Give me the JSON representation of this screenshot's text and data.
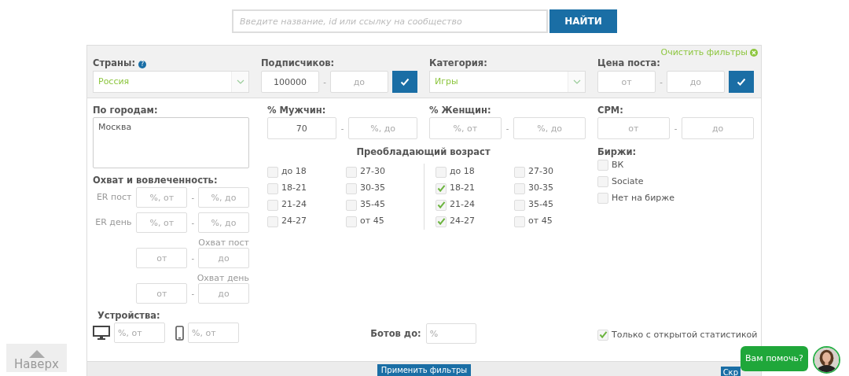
{
  "search": {
    "placeholder": "Введите название, id или ссылку на сообщество",
    "button": "НАЙТИ"
  },
  "clear_filters": {
    "label": "Очистить фильтры"
  },
  "header_filters": [
    {
      "kind": "select",
      "label": "Страны:",
      "help": "?",
      "value": "Россия"
    },
    {
      "kind": "range",
      "label": "Подписчиков:",
      "from": {
        "value": "100000"
      },
      "separator": "-",
      "to": {
        "placeholder": "до"
      },
      "apply": true
    },
    {
      "kind": "select",
      "label": "Категория:",
      "value": "Игры"
    },
    {
      "kind": "range",
      "label": "Цена поста:",
      "from": {
        "placeholder": "от"
      },
      "separator": "-",
      "to": {
        "placeholder": "до"
      },
      "apply": true
    }
  ],
  "cities": {
    "label": "По городам:",
    "value": "Москва"
  },
  "reach": {
    "label": "Охват и вовлеченность:",
    "rows": [
      {
        "kind": "labeled",
        "label": "ER пост",
        "from": {
          "placeholder": "%, от"
        },
        "separator": "-",
        "to": {
          "placeholder": "%, до"
        }
      },
      {
        "kind": "labeled",
        "label": "ER день",
        "from": {
          "placeholder": "%, от"
        },
        "separator": "-",
        "to": {
          "placeholder": "%, до"
        }
      },
      {
        "kind": "captioned",
        "label": "Охват пост",
        "from": {
          "placeholder": "от"
        },
        "separator": "-",
        "to": {
          "placeholder": "до"
        }
      },
      {
        "kind": "captioned",
        "label": "Охват день",
        "from": {
          "placeholder": "от"
        },
        "separator": "-",
        "to": {
          "placeholder": "до"
        }
      }
    ]
  },
  "devices": {
    "label": "Устройства:",
    "items": [
      {
        "kind": "desktop",
        "placeholder": "%, от"
      },
      {
        "kind": "mobile",
        "placeholder": "%, от"
      }
    ]
  },
  "men": {
    "label": "% Мужчин:",
    "from": {
      "value": "70"
    },
    "separator": "-",
    "to": {
      "placeholder": "%, до"
    }
  },
  "women": {
    "label": "% Женщин:",
    "from": {
      "placeholder": "%, от"
    },
    "separator": "-",
    "to": {
      "placeholder": "%, до"
    }
  },
  "age": {
    "title": "Преобладающий возраст",
    "groups": [
      {
        "options": [
          {
            "label": "до 18",
            "checked": false
          },
          {
            "label": "18-21",
            "checked": false
          },
          {
            "label": "21-24",
            "checked": false
          },
          {
            "label": "24-27",
            "checked": false
          },
          {
            "label": "27-30",
            "checked": false
          },
          {
            "label": "30-35",
            "checked": false
          },
          {
            "label": "35-45",
            "checked": false
          },
          {
            "label": "от 45",
            "checked": false
          }
        ]
      },
      {
        "options": [
          {
            "label": "до 18",
            "checked": false
          },
          {
            "label": "18-21",
            "checked": true
          },
          {
            "label": "21-24",
            "checked": true
          },
          {
            "label": "24-27",
            "checked": true
          },
          {
            "label": "27-30",
            "checked": false
          },
          {
            "label": "30-35",
            "checked": false
          },
          {
            "label": "35-45",
            "checked": false
          },
          {
            "label": "от 45",
            "checked": false
          }
        ]
      }
    ]
  },
  "bots": {
    "label": "Ботов до:",
    "placeholder": "%"
  },
  "cpm": {
    "label": "CPM:",
    "from": {
      "placeholder": "от"
    },
    "separator": "-",
    "to": {
      "placeholder": "до"
    }
  },
  "exchanges": {
    "label": "Биржи:",
    "options": [
      {
        "label": "ВК",
        "checked": false
      },
      {
        "label": "Sociate",
        "checked": false
      },
      {
        "label": "Нет на бирже",
        "checked": false
      }
    ]
  },
  "open_stats": {
    "label": "Только с открытой статистикой",
    "checked": true
  },
  "footer": {
    "apply": "Применить фильтры",
    "hide": "Скр"
  },
  "to_top": {
    "label": "Наверх"
  },
  "chat": {
    "message": "Вам помочь?"
  }
}
